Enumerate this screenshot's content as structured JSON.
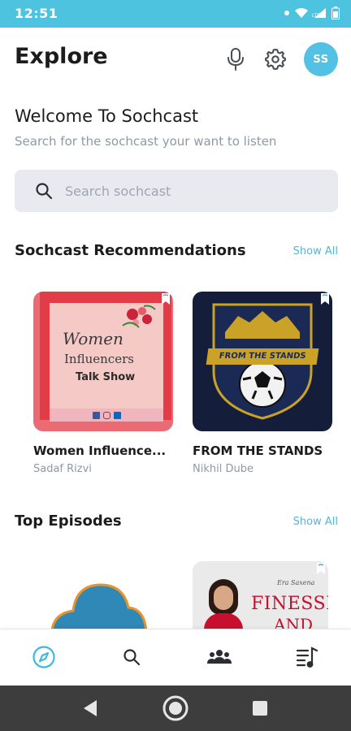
{
  "status_bar": {
    "time": "12:51",
    "network_label": "LTE"
  },
  "header": {
    "title": "Explore",
    "avatar_initials": "SS",
    "icons": [
      "microphone-icon",
      "gear-icon"
    ]
  },
  "welcome": {
    "title": "Welcome To Sochcast",
    "subtitle": "Search for the sochcast your want to listen"
  },
  "search": {
    "placeholder": "Search sochcast",
    "value": ""
  },
  "recommendations": {
    "title": "Sochcast Recommendations",
    "show_all": "Show All",
    "items": [
      {
        "title": "Women Influence...",
        "author": "Sadaf Rizvi",
        "art_text_1": "Women",
        "art_text_2": "Influencers",
        "art_text_3": "Talk Show"
      },
      {
        "title": "FROM THE STANDS",
        "author": "Nikhil Dube",
        "art_text": "FROM THE STANDS"
      }
    ]
  },
  "top_episodes": {
    "title": "Top Episodes",
    "show_all": "Show All",
    "items": [
      {
        "art_text_1": "Era Saxena",
        "art_text_2": "FINESSE",
        "art_text_3": "AND"
      }
    ]
  },
  "bottom_nav": {
    "items": [
      "explore-icon",
      "search-icon",
      "community-icon",
      "playlist-icon"
    ],
    "active": "explore-icon",
    "accent": "#3fb8de"
  },
  "colors": {
    "status_bar": "#4ec3e0",
    "accent": "#4fb6d8",
    "avatar": "#52c1e3"
  }
}
